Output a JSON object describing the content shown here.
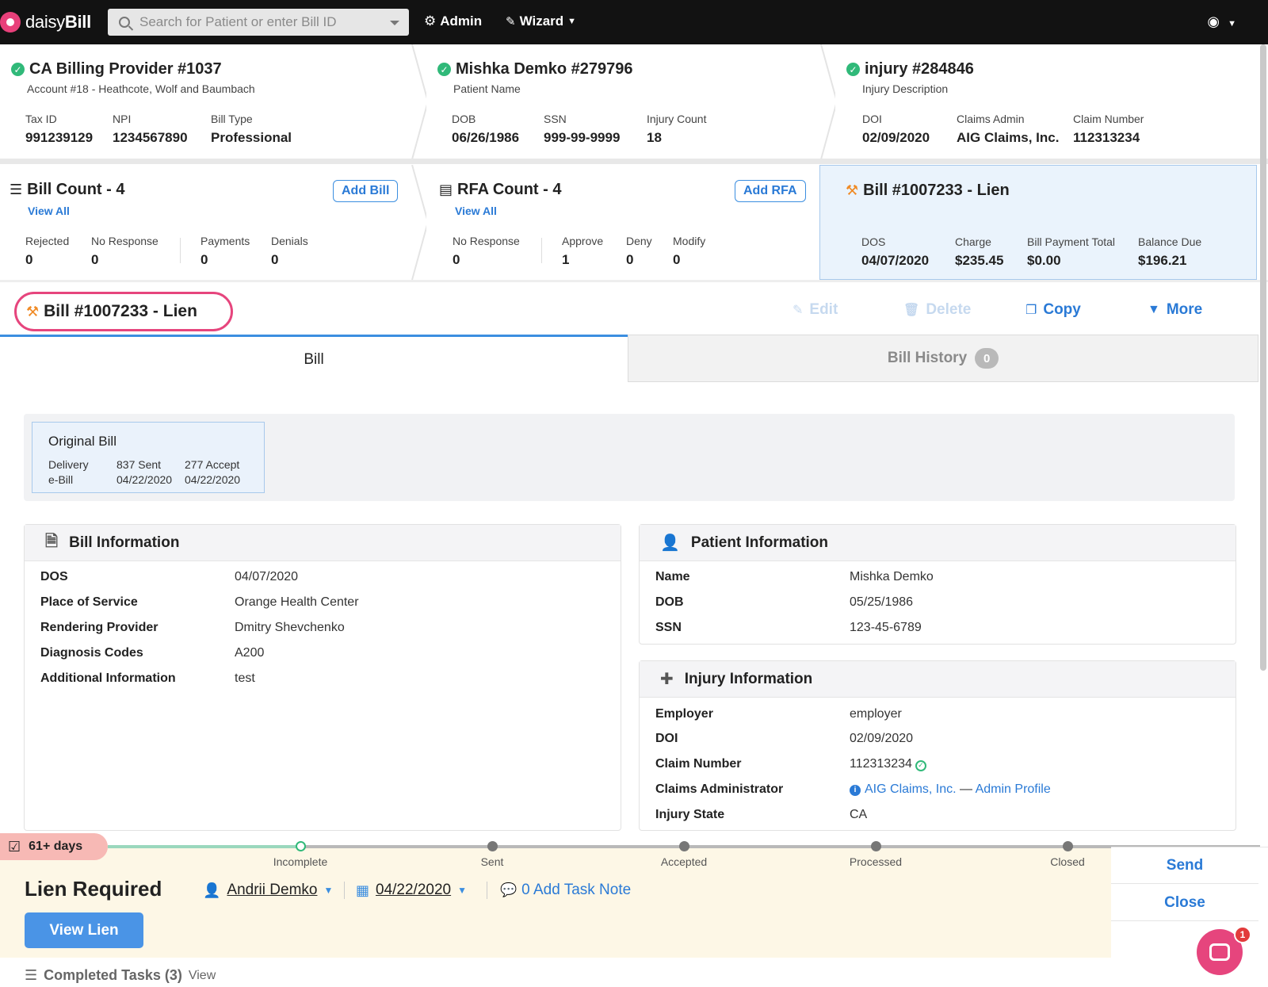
{
  "nav": {
    "logo_text_a": "daisy",
    "logo_text_b": "Bill",
    "search_placeholder": "Search for Patient or enter Bill ID",
    "admin": "Admin",
    "wizard": "Wizard"
  },
  "provider": {
    "title": "CA Billing Provider #1037",
    "subtitle": "Account #18 - Heathcote, Wolf and Baumbach",
    "fields": [
      {
        "label": "Tax ID",
        "value": "991239129"
      },
      {
        "label": "NPI",
        "value": "1234567890"
      },
      {
        "label": "Bill Type",
        "value": "Professional"
      }
    ]
  },
  "patient": {
    "title": "Mishka Demko #279796",
    "subtitle": "Patient Name",
    "fields": [
      {
        "label": "DOB",
        "value": "06/26/1986"
      },
      {
        "label": "SSN",
        "value": "999-99-9999"
      },
      {
        "label": "Injury Count",
        "value": "18"
      }
    ]
  },
  "injury": {
    "title": "injury #284846",
    "subtitle": "Injury Description",
    "fields": [
      {
        "label": "DOI",
        "value": "02/09/2020"
      },
      {
        "label": "Claims Admin",
        "value": "AIG Claims, Inc."
      },
      {
        "label": "Claim Number",
        "value": "112313234"
      }
    ]
  },
  "bills_panel": {
    "title": "Bill Count - 4",
    "view_all": "View All",
    "add": "Add Bill",
    "fields": [
      {
        "label": "Rejected",
        "value": "0"
      },
      {
        "label": "No Response",
        "value": "0"
      },
      {
        "label": "Payments",
        "value": "0"
      },
      {
        "label": "Denials",
        "value": "0"
      }
    ]
  },
  "rfa_panel": {
    "title": "RFA Count - 4",
    "view_all": "View All",
    "add": "Add RFA",
    "fields": [
      {
        "label": "No Response",
        "value": "0"
      },
      {
        "label": "Approve",
        "value": "1"
      },
      {
        "label": "Deny",
        "value": "0"
      },
      {
        "label": "Modify",
        "value": "0"
      }
    ]
  },
  "current_bill_panel": {
    "title": "Bill #1007233 - Lien",
    "fields": [
      {
        "label": "DOS",
        "value": "04/07/2020"
      },
      {
        "label": "Charge",
        "value": "$235.45"
      },
      {
        "label": "Bill Payment Total",
        "value": "$0.00"
      },
      {
        "label": "Balance Due",
        "value": "$196.21"
      }
    ]
  },
  "bill_header": {
    "title": "Bill #1007233 - Lien",
    "edit": "Edit",
    "delete": "Delete",
    "copy": "Copy",
    "more": "More"
  },
  "tabs": {
    "bill": "Bill",
    "history": "Bill History",
    "history_count": "0"
  },
  "original_bill": {
    "title": "Original Bill",
    "col1_a": "Delivery",
    "col1_b": "e-Bill",
    "col2_a": "837 Sent",
    "col2_b": "04/22/2020",
    "col3_a": "277 Accept",
    "col3_b": "04/22/2020"
  },
  "bill_info": {
    "title": "Bill Information",
    "rows": [
      {
        "k": "DOS",
        "v": "04/07/2020"
      },
      {
        "k": "Place of Service",
        "v": "Orange Health Center"
      },
      {
        "k": "Rendering Provider",
        "v": "Dmitry Shevchenko"
      },
      {
        "k": "Diagnosis Codes",
        "v": "A200"
      },
      {
        "k": "Additional Information",
        "v": "test"
      }
    ]
  },
  "patient_info": {
    "title": "Patient Information",
    "rows": [
      {
        "k": "Name",
        "v": "Mishka Demko"
      },
      {
        "k": "DOB",
        "v": "05/25/1986"
      },
      {
        "k": "SSN",
        "v": "123-45-6789"
      }
    ]
  },
  "injury_info": {
    "title": "Injury Information",
    "employer_k": "Employer",
    "employer_v": "employer",
    "doi_k": "DOI",
    "doi_v": "02/09/2020",
    "claim_k": "Claim Number",
    "claim_v": "112313234",
    "admin_k": "Claims Administrator",
    "admin_v": "AIG Claims, Inc.",
    "admin_sep": "—",
    "admin_profile": "Admin Profile",
    "state_k": "Injury State",
    "state_v": "CA"
  },
  "task": {
    "days": "61+ days",
    "stages": [
      "Incomplete",
      "Sent",
      "Accepted",
      "Processed",
      "Closed"
    ],
    "title": "Lien Required",
    "assignee": "Andrii Demko",
    "date": "04/22/2020",
    "note": "0 Add Task Note",
    "view_lien": "View Lien",
    "send": "Send",
    "close": "Close",
    "completed_label": "Completed Tasks (3)",
    "completed_view": "View",
    "chat_badge": "1"
  },
  "colors": {
    "accent": "#2a7ad6",
    "success": "#30b979",
    "highlight": "#e6457d",
    "task_bg": "#fdf7e6"
  }
}
